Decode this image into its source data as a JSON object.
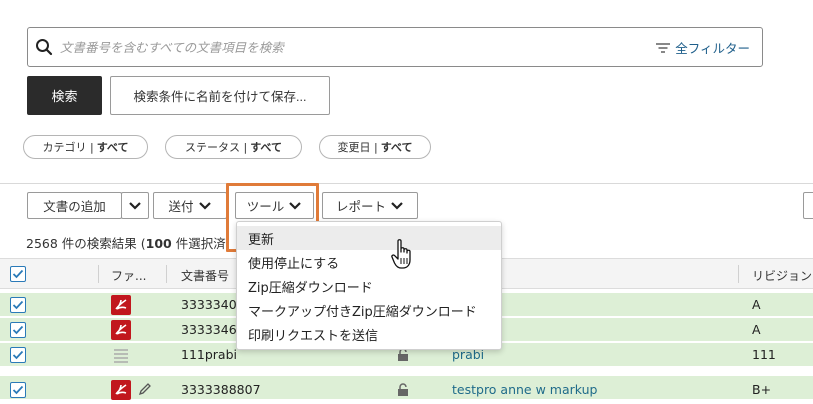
{
  "search": {
    "placeholder": "文書番号を含むすべての文書項目を検索",
    "filter_label": "全フィルター"
  },
  "actions": {
    "search_button": "検索",
    "save_search_button": "検索条件に名前を付けて保存..."
  },
  "chips": [
    {
      "label": "カテゴリ |",
      "value": "すべて"
    },
    {
      "label": "ステータス |",
      "value": "すべて"
    },
    {
      "label": "変更日 |",
      "value": "すべて"
    }
  ],
  "toolbar": {
    "add_document": "文書の追加",
    "send": "送付",
    "tools": "ツール",
    "report": "レポート"
  },
  "results": {
    "prefix": "2568 件の検索結果 (",
    "selected": "100",
    "suffix": " 件選択済"
  },
  "table": {
    "headers": {
      "file": "ファ...",
      "doc_number": "文書番号",
      "revision": "リビジョン"
    },
    "rows": [
      {
        "doc_number": "3333340",
        "title": "",
        "revision": "A",
        "file_type": "pdf",
        "highlight": true
      },
      {
        "doc_number": "3333346",
        "title": "",
        "revision": "A",
        "file_type": "pdf",
        "highlight": true
      },
      {
        "doc_number": "111prabi",
        "title": "prabi",
        "revision": "111",
        "file_type": "doc",
        "highlight": true
      },
      {
        "doc_number": "3333388807",
        "title": "testpro anne w markup",
        "revision": "B+",
        "file_type": "pdf",
        "highlight": true
      }
    ]
  },
  "tools_menu": {
    "items": [
      "更新",
      "使用停止にする",
      "Zip圧縮ダウンロード",
      "マークアップ付きZip圧縮ダウンロード",
      "印刷リクエストを送信"
    ],
    "hovered_index": 0
  },
  "colors": {
    "primary_button": "#2b2b2b",
    "row_highlight": "#ddefd6",
    "link": "#1f6b8a",
    "checkbox": "#2a7ab8",
    "pdf_icon": "#c1171d",
    "focus_outline": "#e07b39"
  }
}
